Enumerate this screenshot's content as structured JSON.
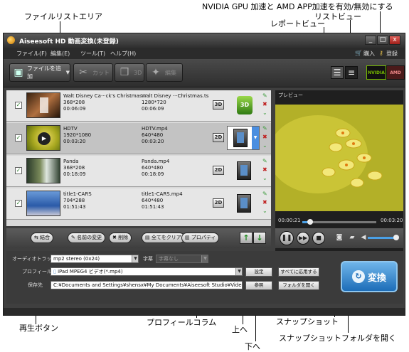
{
  "annotations": {
    "gpu": "NVIDIA GPU 加速と AMD APP加速を有効/無効にする",
    "file_list": "ファイルリストエリア",
    "list_view": "リストビュー",
    "report_view": "レポートビュー",
    "play_button": "再生ボタン",
    "profile_column": "プロフィールコラム",
    "up": "上へ",
    "down": "下へ",
    "snapshot": "スナップショット",
    "snapshot_folder": "スナップショットフォルダを開く"
  },
  "window": {
    "title": "Aiseesoft HD 動画変換(未登録)",
    "controls": {
      "minimize": "_",
      "maximize": "□",
      "close": "x"
    }
  },
  "menu": {
    "items": [
      "ファイル(F)",
      "編集(E)",
      "ツール(T)",
      "ヘルプ(H)"
    ],
    "purchase": "購入",
    "register": "登録"
  },
  "toolbar": {
    "add_file": "ファイルを追加",
    "cut": "カット",
    "three_d": "3D",
    "edit": "編集",
    "nvidia": "NVIDIA",
    "amd": "AMD"
  },
  "files": [
    {
      "src_name": "Walt Disney Ca···ck's Christmas",
      "src_res": "368*208",
      "src_dur": "00:06:09",
      "dst_name": "Walt Disney ···Christmas.ts",
      "dst_res": "1280*720",
      "dst_dur": "00:06:09",
      "mode": "3D",
      "selected": false
    },
    {
      "src_name": "HDTV",
      "src_res": "1920*1080",
      "src_dur": "00:03:20",
      "dst_name": "HDTV.mp4",
      "dst_res": "640*480",
      "dst_dur": "00:03:20",
      "mode": "2D",
      "selected": true
    },
    {
      "src_name": "Panda",
      "src_res": "368*208",
      "src_dur": "00:18:09",
      "dst_name": "Panda.mp4",
      "dst_res": "640*480",
      "dst_dur": "00:18:09",
      "mode": "2D",
      "selected": false
    },
    {
      "src_name": "title1-CARS",
      "src_res": "704*288",
      "src_dur": "01:51:43",
      "dst_name": "title1-CARS.mp4",
      "dst_res": "640*480",
      "dst_dur": "01:51:43",
      "mode": "2D",
      "selected": false
    }
  ],
  "preview": {
    "label": "プレビュー",
    "current_time": "00:00:21",
    "total_time": "00:03:20",
    "progress": 0.105
  },
  "actions": {
    "merge": "結合",
    "rename": "名前の変更",
    "delete": "削除",
    "clear_all": "全てをクリア",
    "properties": "プロパティ"
  },
  "settings": {
    "audio_label": "オーディオトラック",
    "audio_value": "mp2 stereo (0x24)",
    "subtitle_label": "字幕",
    "subtitle_value": "字幕なし",
    "profile_label": "プロフィール",
    "profile_value": "iPad MPEG4 ビデオ(*.mp4)",
    "settings_btn": "設定",
    "apply_all_btn": "すべてに応用する",
    "dest_label": "保存先",
    "dest_value": "C:¥Documents and Settings¥shensx¥My Documents¥Aiseesoft Studio¥Video",
    "browse_btn": "参照",
    "open_folder_btn": "フォルダを開く",
    "convert": "変換"
  },
  "colors": {
    "accent": "#1d6db8",
    "nvidia": "#76b900",
    "amd": "#c8102e"
  }
}
